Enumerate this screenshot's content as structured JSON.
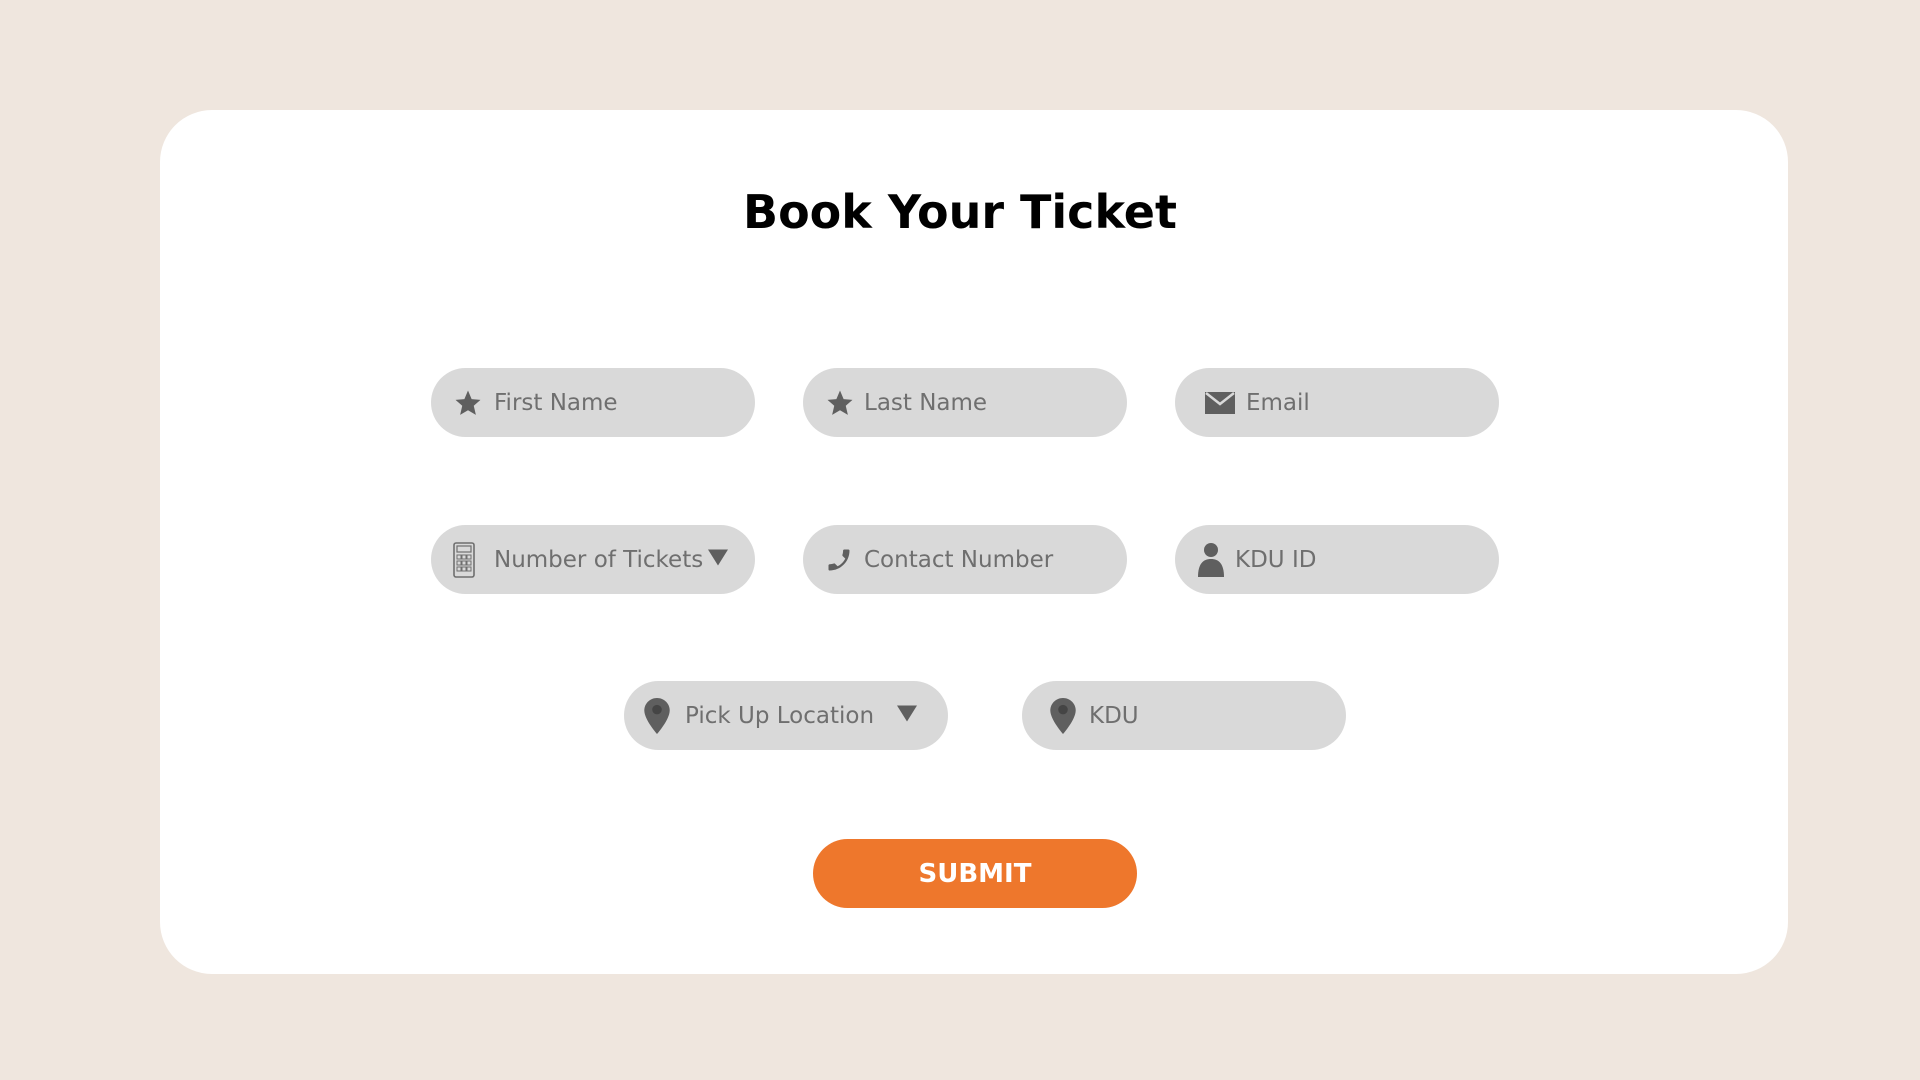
{
  "form": {
    "title": "Book Your Ticket",
    "fields": {
      "first_name": {
        "placeholder": "First Name",
        "icon": "star-icon"
      },
      "last_name": {
        "placeholder": "Last Name",
        "icon": "star-icon"
      },
      "email": {
        "placeholder": "Email",
        "icon": "envelope-icon"
      },
      "num_tickets": {
        "placeholder": "Number of Tickets",
        "icon": "calculator-icon",
        "dropdown": true
      },
      "contact_number": {
        "placeholder": "Contact Number",
        "icon": "phone-icon"
      },
      "kdu_id": {
        "placeholder": "KDU ID",
        "icon": "person-icon"
      },
      "pickup_location": {
        "placeholder": "Pick Up Location",
        "icon": "location-pin-icon",
        "dropdown": true
      },
      "destination": {
        "placeholder": "KDU",
        "icon": "location-pin-icon"
      }
    },
    "submit_label": "SUBMIT"
  },
  "colors": {
    "background": "#efe6de",
    "card": "#ffffff",
    "field": "#d9d9d9",
    "field_text": "#6f6f6f",
    "icon": "#5f5f5f",
    "accent": "#ee772c"
  }
}
